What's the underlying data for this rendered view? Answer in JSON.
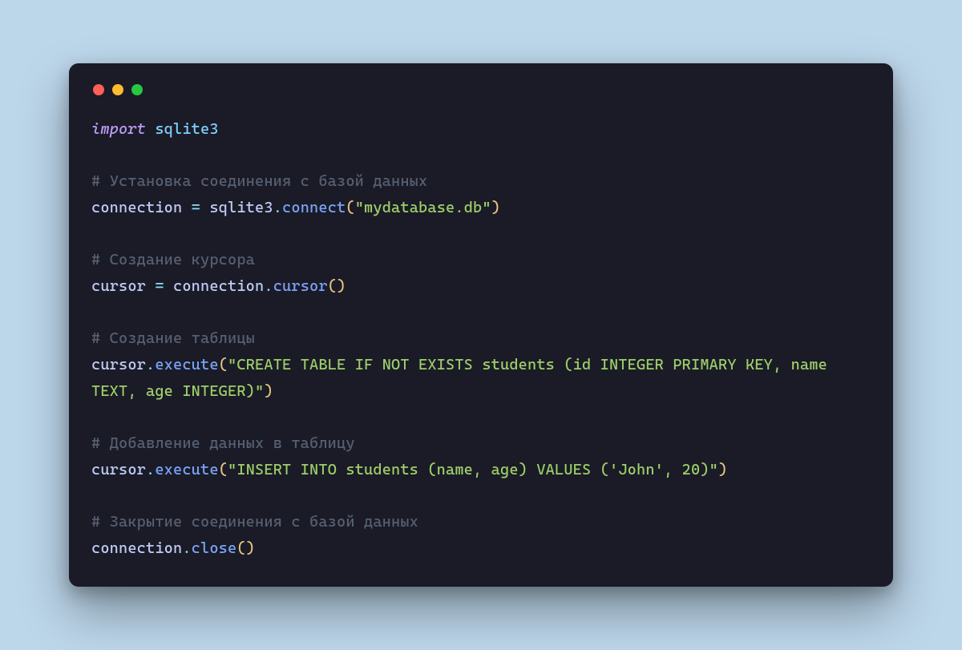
{
  "theme": {
    "background": "#bcd6ea",
    "window_bg": "#1a1b26",
    "traffic_red": "#ff5f57",
    "traffic_yellow": "#febc2e",
    "traffic_green": "#28c840",
    "keyword": "#bb9af7",
    "module": "#7dcfff",
    "comment": "#565f73",
    "identifier": "#c0caf5",
    "operator": "#89ddff",
    "method": "#7aa2f7",
    "string": "#9ece6a",
    "paren": "#e6c384"
  },
  "code": {
    "language": "python",
    "lines": [
      {
        "type": "code",
        "tokens": [
          {
            "cls": "tok-keyword",
            "t": "import"
          },
          {
            "cls": "",
            "t": " "
          },
          {
            "cls": "tok-module",
            "t": "sqlite3"
          }
        ]
      },
      {
        "type": "blank"
      },
      {
        "type": "code",
        "tokens": [
          {
            "cls": "tok-comment",
            "t": "# Установка соединения с базой данных"
          }
        ]
      },
      {
        "type": "code",
        "tokens": [
          {
            "cls": "tok-ident",
            "t": "connection "
          },
          {
            "cls": "tok-op",
            "t": "="
          },
          {
            "cls": "tok-ident",
            "t": " sqlite3"
          },
          {
            "cls": "tok-op",
            "t": "."
          },
          {
            "cls": "tok-method",
            "t": "connect"
          },
          {
            "cls": "tok-paren",
            "t": "("
          },
          {
            "cls": "tok-string",
            "t": "\"mydatabase.db\""
          },
          {
            "cls": "tok-paren",
            "t": ")"
          }
        ]
      },
      {
        "type": "blank"
      },
      {
        "type": "code",
        "tokens": [
          {
            "cls": "tok-comment",
            "t": "# Создание курсора"
          }
        ]
      },
      {
        "type": "code",
        "tokens": [
          {
            "cls": "tok-ident",
            "t": "cursor "
          },
          {
            "cls": "tok-op",
            "t": "="
          },
          {
            "cls": "tok-ident",
            "t": " connection"
          },
          {
            "cls": "tok-op",
            "t": "."
          },
          {
            "cls": "tok-method",
            "t": "cursor"
          },
          {
            "cls": "tok-paren",
            "t": "()"
          }
        ]
      },
      {
        "type": "blank"
      },
      {
        "type": "code",
        "tokens": [
          {
            "cls": "tok-comment",
            "t": "# Создание таблицы"
          }
        ]
      },
      {
        "type": "code",
        "tokens": [
          {
            "cls": "tok-ident",
            "t": "cursor"
          },
          {
            "cls": "tok-op",
            "t": "."
          },
          {
            "cls": "tok-method",
            "t": "execute"
          },
          {
            "cls": "tok-paren",
            "t": "("
          },
          {
            "cls": "tok-string",
            "t": "\"CREATE TABLE IF NOT EXISTS students (id INTEGER PRIMARY KEY, name TEXT, age INTEGER)\""
          },
          {
            "cls": "tok-paren",
            "t": ")"
          }
        ]
      },
      {
        "type": "blank"
      },
      {
        "type": "code",
        "tokens": [
          {
            "cls": "tok-comment",
            "t": "# Добавление данных в таблицу"
          }
        ]
      },
      {
        "type": "code",
        "tokens": [
          {
            "cls": "tok-ident",
            "t": "cursor"
          },
          {
            "cls": "tok-op",
            "t": "."
          },
          {
            "cls": "tok-method",
            "t": "execute"
          },
          {
            "cls": "tok-paren",
            "t": "("
          },
          {
            "cls": "tok-string",
            "t": "\"INSERT INTO students (name, age) VALUES ('John', 20)\""
          },
          {
            "cls": "tok-paren",
            "t": ")"
          }
        ]
      },
      {
        "type": "blank"
      },
      {
        "type": "code",
        "tokens": [
          {
            "cls": "tok-comment",
            "t": "# Закрытие соединения с базой данных"
          }
        ]
      },
      {
        "type": "code",
        "tokens": [
          {
            "cls": "tok-ident",
            "t": "connection"
          },
          {
            "cls": "tok-op",
            "t": "."
          },
          {
            "cls": "tok-method",
            "t": "close"
          },
          {
            "cls": "tok-paren",
            "t": "()"
          }
        ]
      }
    ]
  }
}
